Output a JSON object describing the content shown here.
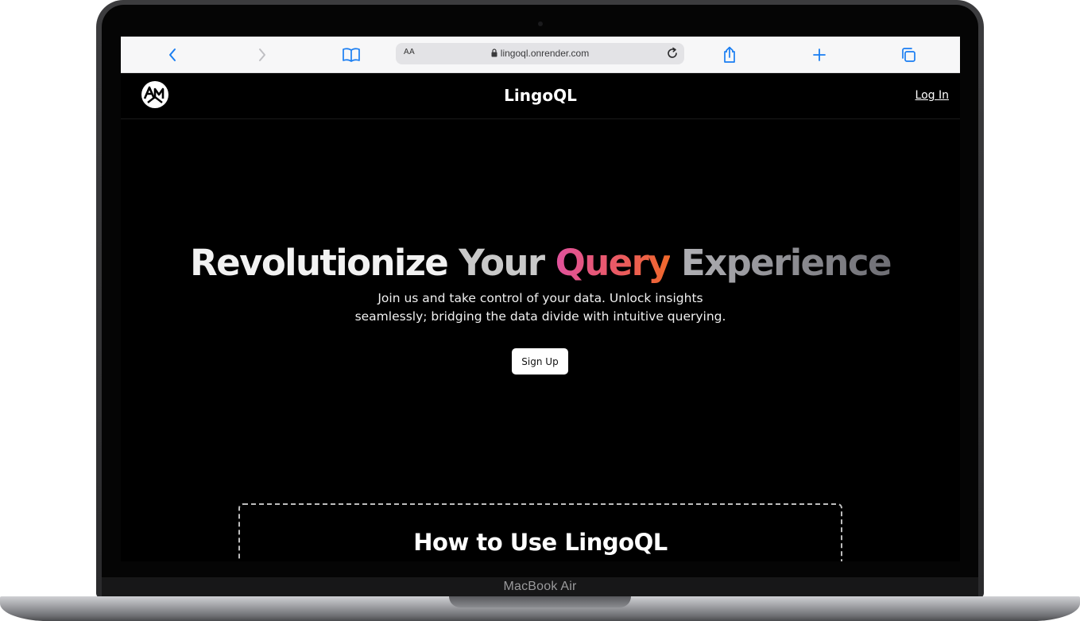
{
  "device": {
    "model_label": "MacBook Air"
  },
  "browser": {
    "aa_label": "AA",
    "url": "lingoql.onrender.com",
    "icons": [
      "back-icon",
      "forward-icon",
      "bookmarks-icon",
      "lock-icon",
      "reload-icon",
      "share-icon",
      "new-tab-icon",
      "tabs-icon"
    ]
  },
  "site": {
    "brand": "LingoQL",
    "login_label": "Log In",
    "hero": {
      "title_part1": "Revolutionize",
      "title_part2": "Your",
      "title_highlight": "Query",
      "title_part3": "Experience",
      "subtitle_line1": "Join us and take control of your data. Unlock insights",
      "subtitle_line2": "seamlessly; bridging the data divide with intuitive querying.",
      "cta_label": "Sign Up"
    },
    "howto": {
      "title": "How to Use LingoQL"
    }
  },
  "colors": {
    "accent_gradient_start": "#e0529c",
    "accent_gradient_end": "#f0682a",
    "safari_blue": "#1a7ef2",
    "page_background": "#000000"
  }
}
